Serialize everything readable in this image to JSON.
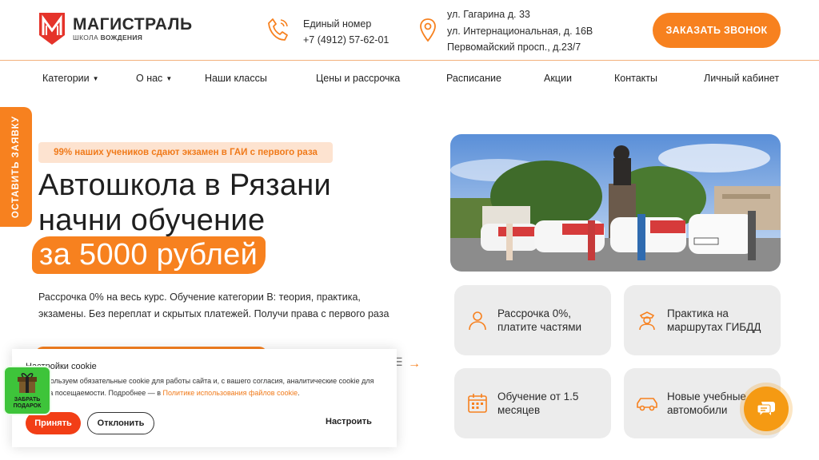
{
  "header": {
    "logo_name": "МАГИСТРАЛЬ",
    "logo_sub_1": "ШКОЛА",
    "logo_sub_2": "ВОЖДЕНИЯ",
    "phone_label": "Единый номер",
    "phone_number": "+7 (4912) 57-62-01",
    "addresses": [
      "ул. Гагарина д. 33",
      "ул. Интернациональная, д. 16В",
      "Первомайский просп., д.23/7"
    ],
    "call_button": "ЗАКАЗАТЬ ЗВОНОК",
    "brand_color": "#f7811f"
  },
  "nav": {
    "items": [
      {
        "label": "Категории",
        "dropdown": true
      },
      {
        "label": "О нас",
        "dropdown": true
      },
      {
        "label": "Наши классы",
        "dropdown": false
      },
      {
        "label": "Цены и рассрочка",
        "dropdown": false
      },
      {
        "label": "Расписание",
        "dropdown": false
      },
      {
        "label": "Акции",
        "dropdown": false
      },
      {
        "label": "Контакты",
        "dropdown": false
      },
      {
        "label": "Личный кабинет",
        "dropdown": false
      }
    ]
  },
  "side_tab": "ОСТАВИТЬ ЗАЯВКУ",
  "hero": {
    "badge": "99% наших учеников сдают экзамен в ГАИ с первого раза",
    "title_line1": "Автошкола в Рязани",
    "title_line2": "начни обучение",
    "price": "за 5000 рублей",
    "description": "Рассрочка 0% на весь курс. Обучение категории B: теория, практика, экзамены. Без переплат и скрытых платежей. Получи права с первого раза"
  },
  "features": [
    {
      "icon": "person-icon",
      "line1": "Рассрочка 0%,",
      "line2": "платите частями"
    },
    {
      "icon": "police-officer-icon",
      "line1": "Практика на",
      "line2": "маршрутах ГИБДД"
    },
    {
      "icon": "calendar-icon",
      "line1": "Обучение от 1.5",
      "line2": "месяцев"
    },
    {
      "icon": "car-icon",
      "line1": "Новые учебные",
      "line2": "автомобили"
    }
  ],
  "cookie": {
    "title": "Настройки cookie",
    "text": "Мы используем обязательные cookie для работы сайта и, с вашего согласия, аналитические cookie для анализа посещаемости. Подробнее — в",
    "link": "Политике использования файлов cookie",
    "text_end": ".",
    "accept": "Принять",
    "decline": "Отклонить",
    "settings": "Настроить"
  },
  "gift": {
    "line1": "ЗАБРАТЬ",
    "line2": "ПОДАРОК"
  }
}
